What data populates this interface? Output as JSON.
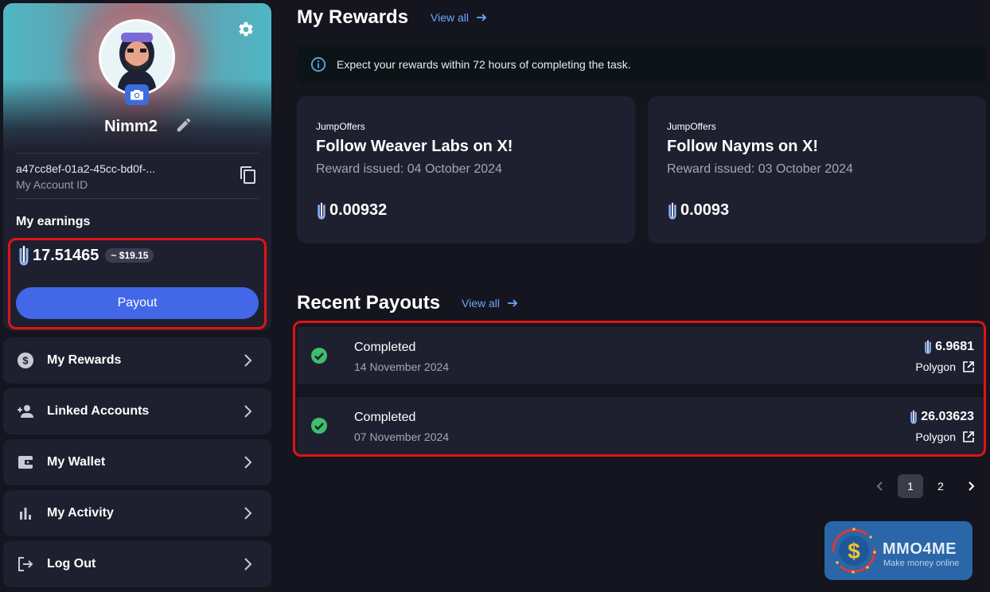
{
  "profile": {
    "username": "Nimm2",
    "account_id": "a47cc8ef-01a2-45cc-bd0f-...",
    "account_id_label": "My Account ID",
    "earnings_label": "My earnings",
    "earnings_amount": "17.51465",
    "earnings_usd": "~ $19.15",
    "payout_label": "Payout"
  },
  "nav": {
    "items": [
      {
        "label": "My Rewards",
        "icon": "dollar-circle-icon"
      },
      {
        "label": "Linked Accounts",
        "icon": "add-person-icon"
      },
      {
        "label": "My Wallet",
        "icon": "wallet-icon"
      },
      {
        "label": "My Activity",
        "icon": "bar-chart-icon"
      },
      {
        "label": "Log Out",
        "icon": "logout-icon"
      }
    ]
  },
  "rewards": {
    "title": "My Rewards",
    "view_all": "View all",
    "info_text": "Expect your rewards within 72 hours of completing the task.",
    "cards": [
      {
        "provider": "JumpOffers",
        "title": "Follow Weaver Labs on X!",
        "issued": "Reward issued: 04 October 2024",
        "amount": "0.00932"
      },
      {
        "provider": "JumpOffers",
        "title": "Follow Nayms on X!",
        "issued": "Reward issued: 03 October 2024",
        "amount": "0.0093"
      }
    ]
  },
  "payouts": {
    "title": "Recent Payouts",
    "view_all": "View all",
    "rows": [
      {
        "status": "Completed",
        "date": "14 November 2024",
        "amount": "6.9681",
        "network": "Polygon"
      },
      {
        "status": "Completed",
        "date": "07 November 2024",
        "amount": "26.03623",
        "network": "Polygon"
      }
    ]
  },
  "pagination": {
    "pages": [
      "1",
      "2"
    ],
    "current": "1"
  },
  "watermark": {
    "title": "MMO4ME",
    "subtitle": "Make money online"
  },
  "colors": {
    "background": "#14151f",
    "card": "#1e2030",
    "accent_blue": "#4268e8",
    "link_blue": "#6ea6ff",
    "success_green": "#3fbf6a",
    "highlight_red": "#e01414"
  }
}
